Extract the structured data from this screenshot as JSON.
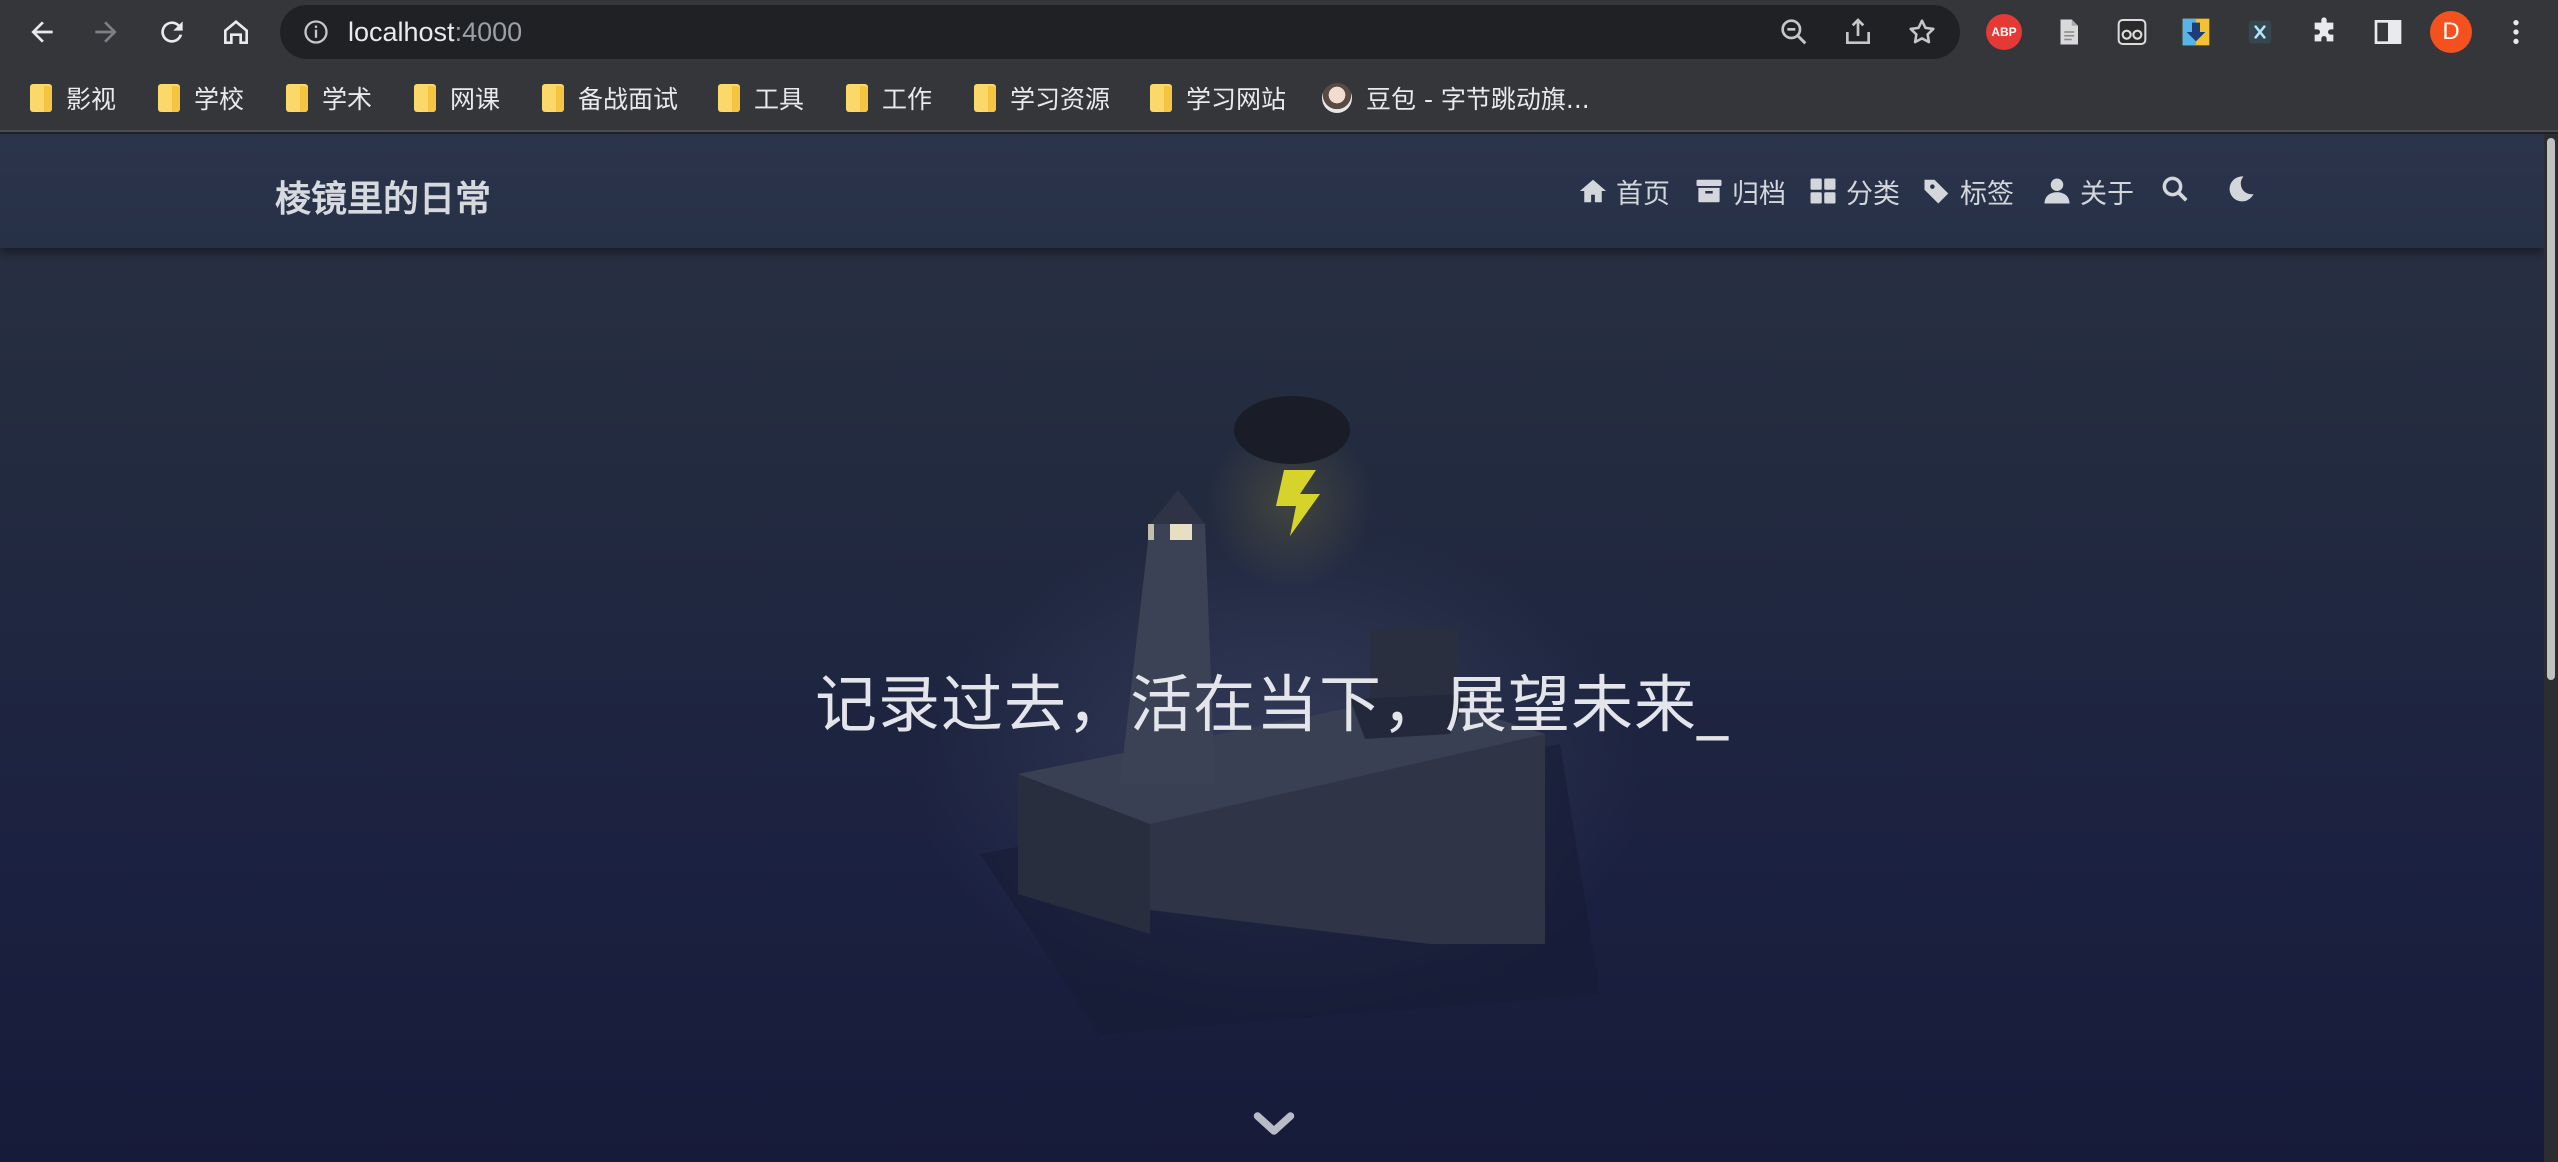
{
  "browser": {
    "url_host": "localhost",
    "url_port": ":4000",
    "abp_label": "ABP",
    "profile_initial": "D",
    "bookmarks": [
      {
        "label": "影视",
        "icon": "folder-icon"
      },
      {
        "label": "学校",
        "icon": "folder-icon"
      },
      {
        "label": "学术",
        "icon": "folder-icon"
      },
      {
        "label": "网课",
        "icon": "folder-icon"
      },
      {
        "label": "备战面试",
        "icon": "folder-icon"
      },
      {
        "label": "工具",
        "icon": "folder-icon"
      },
      {
        "label": "工作",
        "icon": "folder-icon"
      },
      {
        "label": "学习资源",
        "icon": "folder-icon"
      },
      {
        "label": "学习网站",
        "icon": "folder-icon"
      },
      {
        "label": "豆包 - 字节跳动旗...",
        "icon": "doubao-favicon"
      }
    ]
  },
  "site": {
    "title": "棱镜里的日常",
    "menu": [
      {
        "label": "首页",
        "icon": "home-icon"
      },
      {
        "label": "归档",
        "icon": "archive-icon"
      },
      {
        "label": "分类",
        "icon": "category-icon"
      },
      {
        "label": "标签",
        "icon": "tags-icon"
      },
      {
        "label": "关于",
        "icon": "user-icon"
      }
    ],
    "search_icon": "search-icon",
    "theme_icon": "moon-icon"
  },
  "hero": {
    "subtitle": "记录过去，活在当下，展望未来_",
    "scroll_icon": "chevron-down-icon"
  },
  "colors": {
    "chrome": "#35363a",
    "omnibox": "#202124",
    "header": "#263047",
    "hero_bottom": "#171b3a",
    "lightning": "#d6d42a"
  }
}
